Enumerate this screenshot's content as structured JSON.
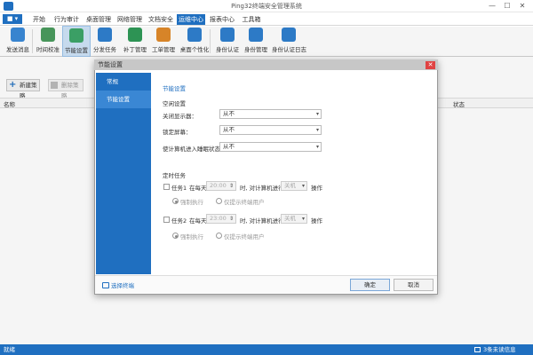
{
  "window": {
    "title": "Ping32终端安全管理系统",
    "minimize": "—",
    "maximize": "☐",
    "close": "✕"
  },
  "menu": {
    "file": "■ ▾",
    "tabs": [
      "开始",
      "行为审计",
      "桌面管理",
      "网络管理",
      "文档安全",
      "运维中心",
      "报表中心",
      "工具箱"
    ],
    "active_tab": "运维中心"
  },
  "ribbon": {
    "items": [
      {
        "label": "发送消息",
        "icon": "message-icon",
        "color": "#3b8ad8"
      },
      {
        "label": "时间校准",
        "icon": "clock-icon",
        "color": "#4a9c5e"
      },
      {
        "label": "节能设置",
        "icon": "leaf-icon",
        "color": "#3ea66a"
      },
      {
        "label": "分发任务",
        "icon": "download-icon",
        "color": "#2f7fcf"
      },
      {
        "label": "补丁管理",
        "icon": "shield-icon",
        "color": "#2f9a58"
      },
      {
        "label": "工单管理",
        "icon": "clipboard-icon",
        "color": "#e08a2a"
      },
      {
        "label": "桌面个性化",
        "icon": "monitor-icon",
        "color": "#2f7fcf"
      },
      {
        "label": "身份认证",
        "icon": "user-icon",
        "color": "#2f7fcf"
      },
      {
        "label": "身份管理",
        "icon": "id-card-icon",
        "color": "#2f7fcf"
      },
      {
        "label": "身份认证日志",
        "icon": "log-icon",
        "color": "#2f7fcf"
      }
    ],
    "selected": "节能设置"
  },
  "toolbar": {
    "new_policy": "新建策略",
    "delete_policy": "删除策略"
  },
  "table": {
    "col_name": "名称",
    "col_status": "状态"
  },
  "status": {
    "left": "就绪",
    "right": "3条未读信息"
  },
  "dialog": {
    "title": "节能设置",
    "close": "✕",
    "side": [
      "常规",
      "节能设置"
    ],
    "side_selected": "节能设置",
    "section_title": "节能设置",
    "power": {
      "heading": "空闲设置",
      "rows": [
        {
          "label": "关闭显示器：",
          "value": "从不"
        },
        {
          "label": "锁定屏幕：",
          "value": "从不"
        },
        {
          "label": "使计算机进入睡眠状态：",
          "value": "从不"
        }
      ]
    },
    "tasks": {
      "heading": "定时任务",
      "task1": {
        "name": "任务1",
        "at": "在每天",
        "time": "20:00",
        "mid": "时, 对计算机进行",
        "action": "关机",
        "suffix": "操作",
        "force": "强制执行",
        "prompt": "仅提示终端用户"
      },
      "task2": {
        "name": "任务2",
        "at": "在每天",
        "time": "23:00",
        "mid": "时, 对计算机进行",
        "action": "关机",
        "suffix": "操作",
        "force": "强制执行",
        "prompt": "仅提示终端用户"
      }
    },
    "footer": {
      "select_terminal": "选择终端",
      "ok": "确定",
      "cancel": "取消"
    }
  }
}
